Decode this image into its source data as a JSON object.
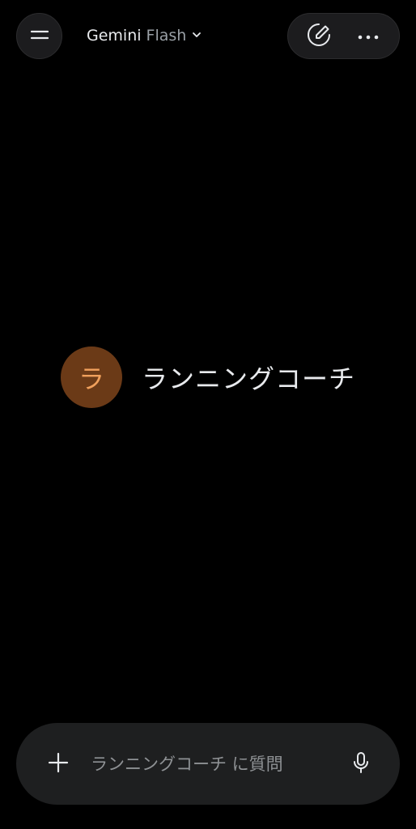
{
  "header": {
    "menu_icon": "menu-icon",
    "model_name": "Gemini",
    "model_variant": "Flash",
    "dropdown_icon": "chevron-down-icon",
    "actions": [
      {
        "icon": "edit-chat-icon"
      },
      {
        "icon": "more-horizontal-icon"
      }
    ]
  },
  "gem": {
    "avatar_letter": "ラ",
    "name": "ランニングコーチ",
    "avatar_bg": "#6b3a17",
    "avatar_fg": "#f0a05c"
  },
  "composer": {
    "add_icon": "plus-icon",
    "placeholder": "ランニングコーチ に質問",
    "value": "",
    "mic_icon": "microphone-icon"
  },
  "colors": {
    "background": "#000000",
    "surface": "#1e1f20",
    "text_primary": "#e8eaed",
    "text_secondary": "#9aa0a6"
  }
}
